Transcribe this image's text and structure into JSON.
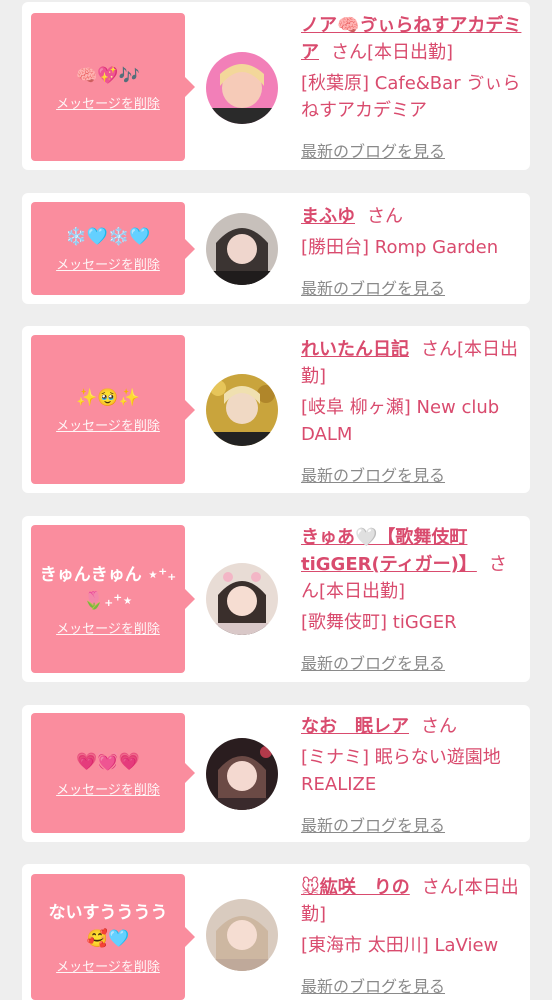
{
  "delete_label": "メッセージを削除",
  "blog_label": "最新のブログを見る",
  "colors": {
    "bubble": "#fa8d9e",
    "name": "#d94b6e",
    "link_gray": "#8a8a8a",
    "background": "#eeeeee"
  },
  "cards": [
    {
      "message": "🧠💖🎶",
      "name": "ノア🧠ゔぃらねすアカデミア",
      "suffix": "さん[本日出勤]",
      "shop": "[秋葉原] Cafe&Bar ゔぃらねすアカデミア"
    },
    {
      "message": "❄️🩵❄️🩵",
      "name": "まふゆ",
      "suffix": "さん",
      "shop": "[勝田台] Romp Garden"
    },
    {
      "message": "✨🥹✨",
      "name": "れいたん日記",
      "suffix": "さん[本日出勤]",
      "shop": "[岐阜 柳ヶ瀬] New club DALM"
    },
    {
      "message": "きゅんきゅん ⋆⁺₊🌷₊⁺⋆",
      "name": "きゅあ🤍【歌舞伎町tiGGER(ティガー)】",
      "suffix": "さん[本日出勤]",
      "shop": "[歌舞伎町] tiGGER"
    },
    {
      "message": "💗💓💗",
      "name": "なお　眠レア",
      "suffix": "さん",
      "shop": "[ミナミ] 眠らない遊園地 REALIZE"
    },
    {
      "message": "ないすうううう🥰🩵",
      "name": "🐭紘咲　りの",
      "suffix": "さん[本日出勤]",
      "shop": "[東海市 太田川] LaView"
    }
  ]
}
